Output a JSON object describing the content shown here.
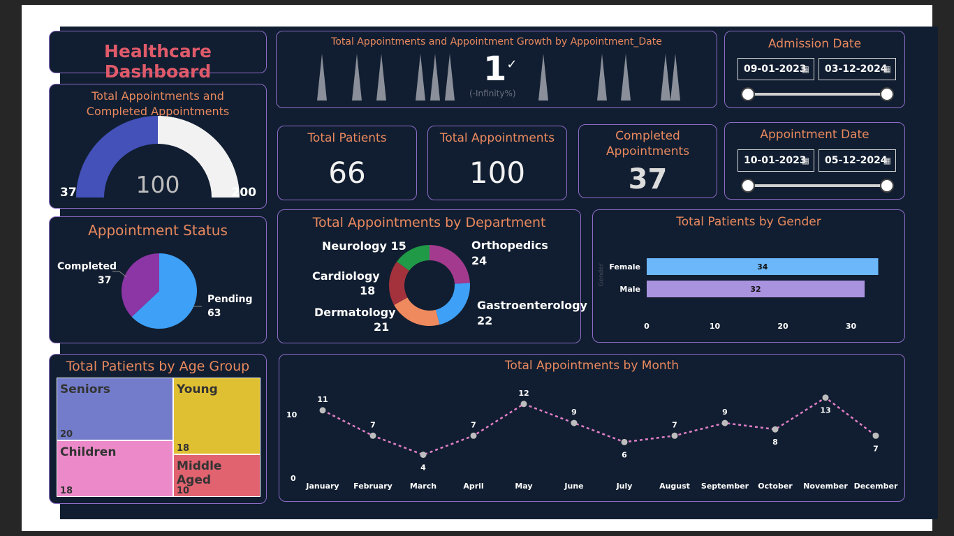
{
  "title": "Healthcare Dashboard",
  "colors": {
    "background": "#111e31",
    "card_border": "#8d6cc7",
    "title_orange": "#e9895e",
    "title_red": "#e05a6a"
  },
  "growth": {
    "title": "Total Appointments and Appointment Growth by Appointment_Date",
    "value": "1",
    "suffix": "(-Infinity%)"
  },
  "admission": {
    "title": "Admission Date",
    "start": "09-01-2023",
    "end": "03-12-2024",
    "calendar_icon": "calendar-icon"
  },
  "appointment_date": {
    "title": "Appointment Date",
    "start": "10-01-2023",
    "end": "05-12-2024",
    "calendar_icon": "calendar-icon"
  },
  "gauge": {
    "title_line1": "Total Appointments and",
    "title_line2": "Completed Appointments",
    "min": "37",
    "value": "100",
    "max": "200",
    "value_num": 100,
    "min_num": 0,
    "max_num": 200,
    "target_num": 37
  },
  "kpis": {
    "patients": {
      "label": "Total Patients",
      "value": "66"
    },
    "appointments": {
      "label": "Total Appointments",
      "value": "100"
    },
    "completed": {
      "label_line1": "Completed",
      "label_line2": "Appointments",
      "value": "37"
    }
  },
  "status": {
    "title": "Appointment Status",
    "completed_label": "Completed",
    "completed_value": "37",
    "pending_label": "Pending",
    "pending_value": "63"
  },
  "department": {
    "title": "Total Appointments by Department",
    "neurology": "Neurology 15",
    "orthopedics": "Orthopedics",
    "orthopedics_value": "24",
    "cardiology": "Cardiology",
    "cardiology_value": "18",
    "gastro": "Gastroenterology",
    "gastro_value": "22",
    "dermatology": "Dermatology",
    "dermatology_value": "21"
  },
  "gender": {
    "title": "Total Patients by Gender",
    "axis_title": "Gender",
    "female": "Female",
    "female_value": "34",
    "male": "Male",
    "male_value": "32",
    "ticks": [
      "0",
      "10",
      "20",
      "30"
    ]
  },
  "age": {
    "title": "Total Patients by Age Group",
    "seniors": "Seniors",
    "seniors_value": "20",
    "young": "Young",
    "young_value": "18",
    "children": "Children",
    "children_value": "18",
    "middle": "Middle Aged",
    "middle_value": "10"
  },
  "month": {
    "title": "Total Appointments by Month",
    "y_ticks": [
      "10",
      "0"
    ]
  },
  "chart_data": [
    {
      "type": "bar",
      "title": "Total Patients by Gender",
      "ylabel": "Gender",
      "categories": [
        "Female",
        "Male"
      ],
      "values": [
        34,
        32
      ],
      "xlim": [
        0,
        34
      ],
      "colors": [
        "#6bb7fa",
        "#a993df"
      ]
    },
    {
      "type": "pie",
      "title": "Appointment Status",
      "categories": [
        "Completed",
        "Pending"
      ],
      "values": [
        37,
        63
      ],
      "colors": [
        "#8b36a4",
        "#3ea0f7"
      ]
    },
    {
      "type": "pie",
      "title": "Total Appointments by Department",
      "categories": [
        "Orthopedics",
        "Gastroenterology",
        "Dermatology",
        "Cardiology",
        "Neurology"
      ],
      "values": [
        24,
        22,
        21,
        18,
        15
      ],
      "colors": [
        "#a43a8e",
        "#3ea0f7",
        "#ef8a5e",
        "#a3323d",
        "#209a47"
      ]
    },
    {
      "type": "line",
      "title": "Total Appointments by Month",
      "categories": [
        "January",
        "February",
        "March",
        "April",
        "May",
        "June",
        "July",
        "August",
        "September",
        "October",
        "November",
        "December"
      ],
      "values": [
        11,
        7,
        4,
        7,
        12,
        9,
        6,
        7,
        9,
        8,
        13,
        7
      ],
      "ylim": [
        0,
        15
      ]
    },
    {
      "type": "heatmap",
      "title": "Total Patients by Age Group",
      "categories": [
        "Seniors",
        "Children",
        "Young",
        "Middle Aged"
      ],
      "values": [
        20,
        18,
        18,
        10
      ]
    }
  ]
}
